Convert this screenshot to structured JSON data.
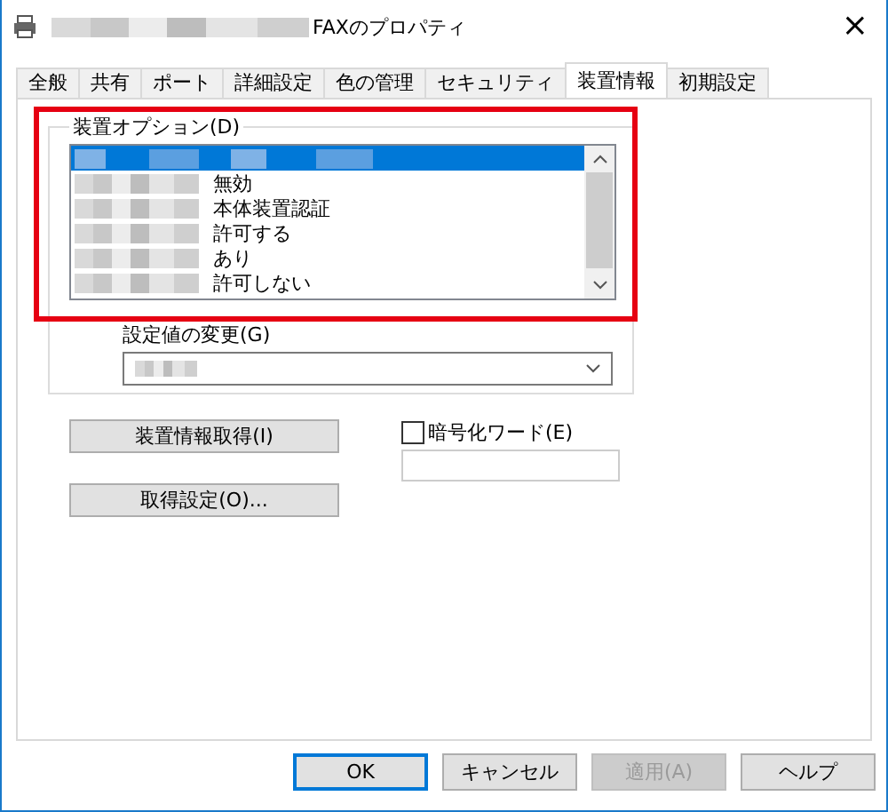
{
  "window": {
    "title": "FAXのプロパティ",
    "title_blurred": true,
    "close": "×"
  },
  "tabs": [
    {
      "label": "全般",
      "selected": false
    },
    {
      "label": "共有",
      "selected": false
    },
    {
      "label": "ポート",
      "selected": false
    },
    {
      "label": "詳細設定",
      "selected": false
    },
    {
      "label": "色の管理",
      "selected": false
    },
    {
      "label": "セキュリティ",
      "selected": false
    },
    {
      "label": "装置情報",
      "selected": true
    },
    {
      "label": "初期設定",
      "selected": false
    }
  ],
  "device_options": {
    "label": "装置オプション(D)",
    "highlighted": true,
    "rows": [
      {
        "name_blurred": true,
        "value_blurred": true,
        "selected": true
      },
      {
        "name_blurred": true,
        "value": "無効",
        "selected": false
      },
      {
        "name_blurred": true,
        "value": "本体装置認証",
        "selected": false
      },
      {
        "name_blurred": true,
        "value": "許可する",
        "selected": false
      },
      {
        "name_blurred": true,
        "value": "あり",
        "selected": false
      },
      {
        "name_blurred": true,
        "value": "許可しない",
        "selected": false
      }
    ],
    "change_label": "設定値の変更(G)",
    "change_value_blurred": true
  },
  "actions": [
    {
      "label": "装置情報取得(I)"
    },
    {
      "label": "取得設定(O)..."
    }
  ],
  "encryption": {
    "label": "暗号化ワード(E)",
    "checked": false
  },
  "buttons": [
    {
      "label": "OK",
      "disabled": false,
      "default": true
    },
    {
      "label": "キャンセル",
      "disabled": false,
      "default": false
    },
    {
      "label": "適用(A)",
      "disabled": true,
      "default": false
    },
    {
      "label": "ヘルプ",
      "disabled": false,
      "default": false
    }
  ]
}
